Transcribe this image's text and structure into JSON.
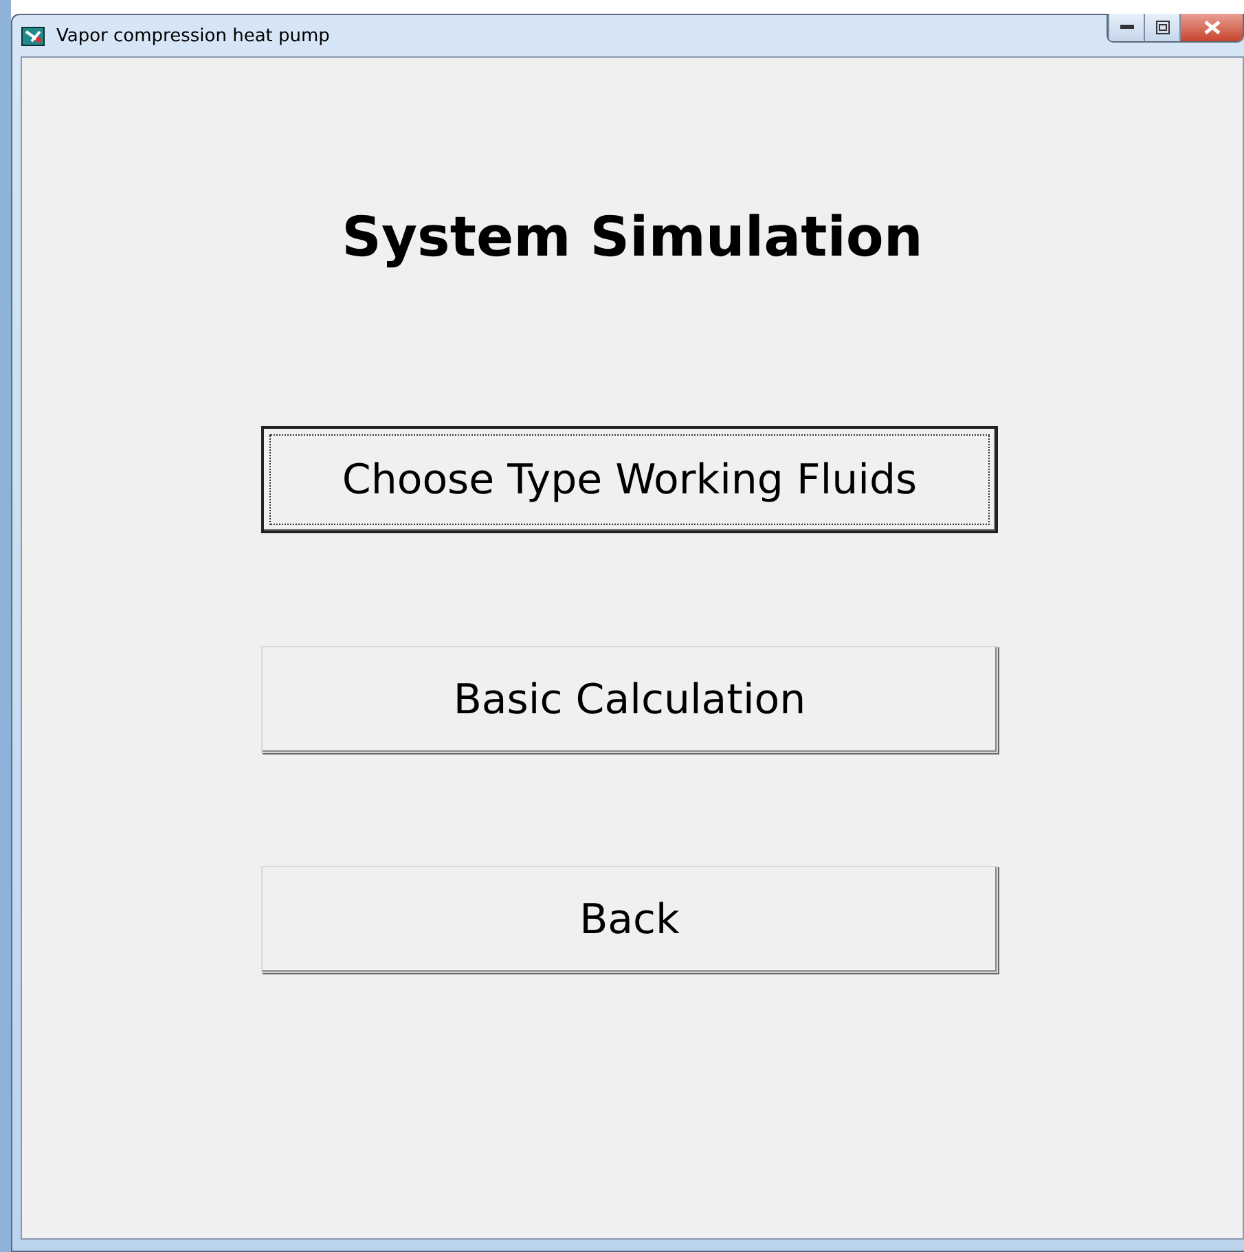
{
  "window": {
    "title": "Vapor compression heat pump"
  },
  "heading": "System Simulation",
  "buttons": [
    {
      "label": "Choose Type Working Fluids",
      "focused": true
    },
    {
      "label": "Basic Calculation",
      "focused": false
    },
    {
      "label": "Back",
      "focused": false
    }
  ]
}
